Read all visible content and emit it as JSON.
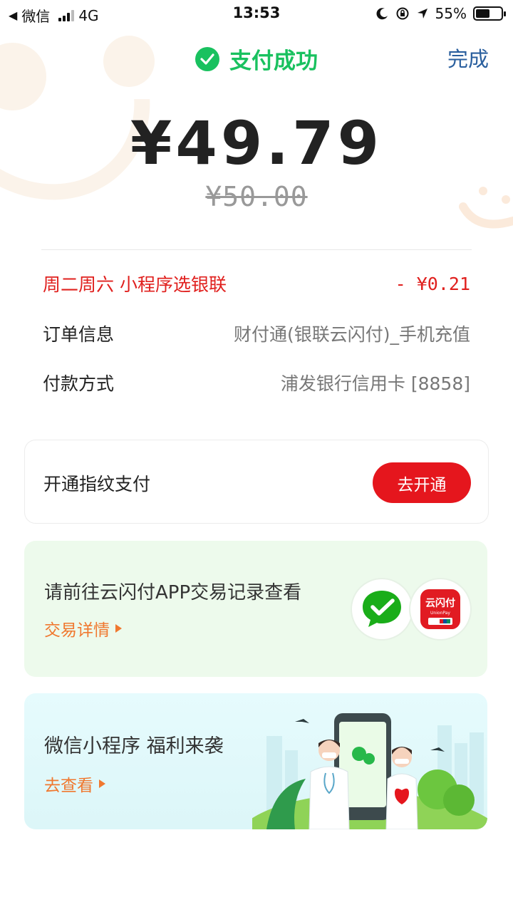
{
  "status_bar": {
    "back_app": "微信",
    "network": "4G",
    "time": "13:53",
    "battery": "55%",
    "battery_level": 0.55
  },
  "header": {
    "title": "支付成功",
    "done_label": "完成"
  },
  "payment": {
    "amount": "¥49.79",
    "original_amount": "¥50.00"
  },
  "details": {
    "discount": {
      "label": "周二周六  小程序选银联",
      "value": "- ¥0.21"
    },
    "order": {
      "label": "订单信息",
      "value": "财付通(银联云闪付)_手机充值"
    },
    "method": {
      "label": "付款方式",
      "value": "浦发银行信用卡 [8858]"
    }
  },
  "fingerprint": {
    "label": "开通指纹支付",
    "button": "去开通"
  },
  "yunshanfu_card": {
    "title": "请前往云闪付APP交易记录查看",
    "link": "交易详情",
    "logo_text": "云闪付",
    "logo_subtext": "UnionPay"
  },
  "miniprogram_card": {
    "title": "微信小程序 福利来袭",
    "link": "去查看"
  },
  "colors": {
    "success_green": "#19c15f",
    "primary_red": "#e5161d",
    "link_orange": "#f0782f",
    "done_blue": "#2a5f9e"
  }
}
